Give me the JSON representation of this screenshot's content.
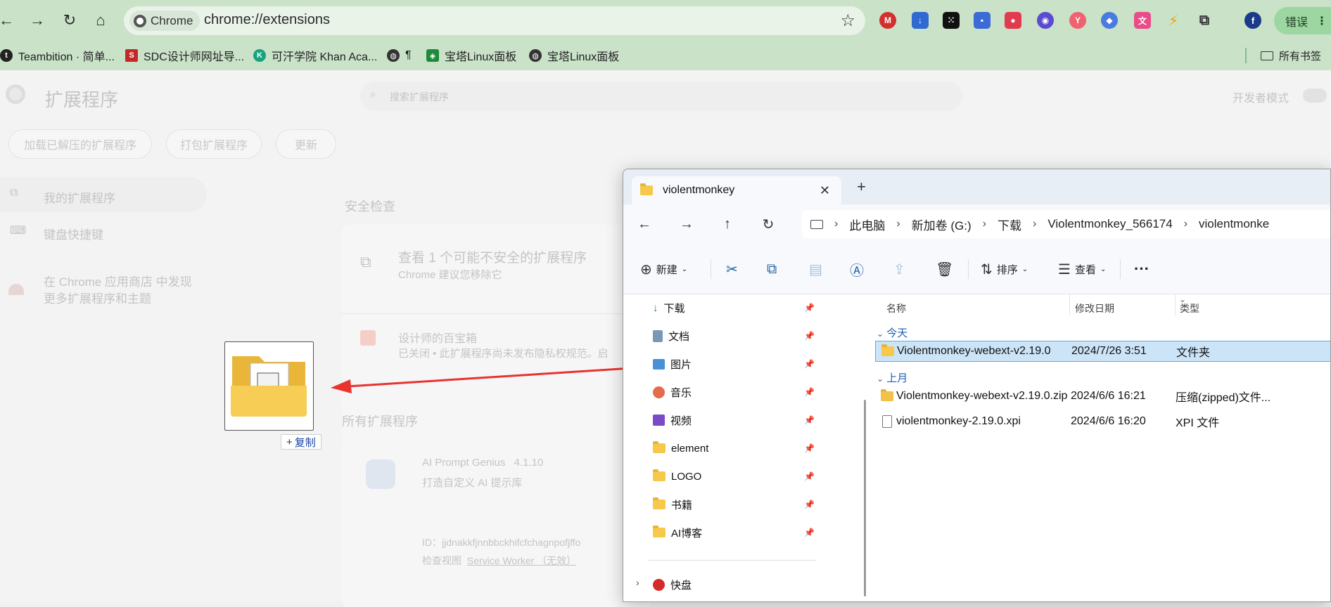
{
  "browser": {
    "chip_label": "Chrome",
    "url": "chrome://extensions",
    "error_button": "错误",
    "extensions_icons": [
      "mail-icon",
      "download-icon",
      "dice-icon",
      "colors-icon",
      "game-icon",
      "bot-icon",
      "translate-icon",
      "vpn-icon",
      "lang-icon",
      "bolt-icon",
      "puzzle-icon"
    ],
    "profile_initial": "f"
  },
  "bookmarks": {
    "items": [
      {
        "label": "Teambition · 简单..."
      },
      {
        "label": "SDC设计师网址导..."
      },
      {
        "label": "可汗学院 Khan Aca..."
      },
      {
        "label": "¶"
      },
      {
        "label": "宝塔Linux面板"
      },
      {
        "label": "宝塔Linux面板"
      }
    ],
    "all_bookmarks": "所有书签"
  },
  "extensions_page": {
    "title": "扩展程序",
    "search_placeholder": "搜索扩展程序",
    "dev_mode": "开发者模式",
    "buttons": [
      "加载已解压的扩展程序",
      "打包扩展程序",
      "更新"
    ],
    "sidebar": [
      "我的扩展程序",
      "键盘快捷键"
    ],
    "store_line1": "在 Chrome 应用商店 中发现",
    "store_line2": "更多扩展程序和主题",
    "safety_title": "安全检查",
    "safety_card_title": "查看 1 个可能不安全的扩展程序",
    "safety_card_sub": "Chrome 建议您移除它",
    "ext1_name": "设计师的百宝箱",
    "ext1_desc": "已关闭 • 此扩展程序尚未发布隐私权规范。启",
    "all_title": "所有扩展程序",
    "ext2_name": "AI Prompt Genius",
    "ext2_version": "4.1.10",
    "ext2_desc": "打造自定义 AI 提示库",
    "ext2_id": "ID：jjdnakkfjnnbbckhifcfchagnpofjffo",
    "ext2_view_label": "检查视图",
    "ext2_view_link": "Service Worker （无效）"
  },
  "drag": {
    "copy_label": "复制"
  },
  "explorer": {
    "tab_title": "violentmonkey",
    "breadcrumbs": [
      "此电脑",
      "新加卷 (G:)",
      "下载",
      "Violentmonkey_566174",
      "violentmonke"
    ],
    "commands": {
      "new": "新建",
      "sort": "排序",
      "view": "查看"
    },
    "nav_items": [
      {
        "label": "下载",
        "icon": "download-icon"
      },
      {
        "label": "文档",
        "icon": "document-icon"
      },
      {
        "label": "图片",
        "icon": "image-icon"
      },
      {
        "label": "音乐",
        "icon": "music-icon"
      },
      {
        "label": "视频",
        "icon": "video-icon"
      },
      {
        "label": "element",
        "icon": "folder-icon"
      },
      {
        "label": "LOGO",
        "icon": "folder-icon"
      },
      {
        "label": "书籍",
        "icon": "folder-icon"
      },
      {
        "label": "AI博客",
        "icon": "folder-icon"
      }
    ],
    "nav_quick": "快盘",
    "columns": {
      "name": "名称",
      "date": "修改日期",
      "type": "类型"
    },
    "groups": {
      "today": "今天",
      "last_month": "上月"
    },
    "files_today": [
      {
        "name": "Violentmonkey-webext-v2.19.0",
        "date": "2024/7/26 3:51",
        "type": "文件夹",
        "selected": true
      }
    ],
    "files_last_month": [
      {
        "name": "Violentmonkey-webext-v2.19.0.zip",
        "date": "2024/6/6 16:21",
        "type": "压缩(zipped)文件..."
      },
      {
        "name": "violentmonkey-2.19.0.xpi",
        "date": "2024/6/6 16:20",
        "type": "XPI 文件"
      }
    ]
  },
  "colors": {
    "toolbar": "#c9e2c8",
    "accent_red": "#e8332f",
    "selection": "#cce4f7"
  }
}
